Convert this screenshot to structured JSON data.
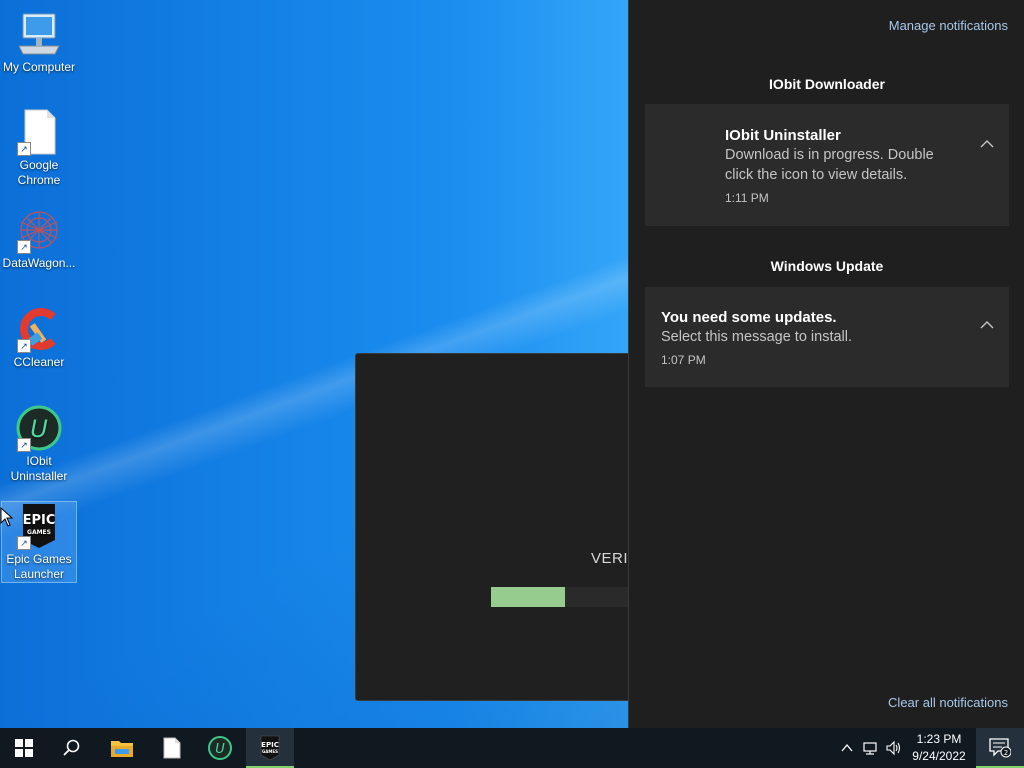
{
  "desktop": {
    "icons": [
      {
        "label": "My Computer",
        "icon": "computer-icon"
      },
      {
        "label": "Google Chrome",
        "icon": "file-icon"
      },
      {
        "label": "DataWagon...",
        "icon": "datawagon-icon"
      },
      {
        "label": "CCleaner",
        "icon": "ccleaner-icon"
      },
      {
        "label": "IObit Uninstaller",
        "icon": "iobit-uninstaller-icon"
      },
      {
        "label": "Epic Games Launcher",
        "icon": "epic-games-icon"
      }
    ]
  },
  "epic_window": {
    "status_text": "VERIF",
    "progress": 0.46,
    "progress_color": "#96cd8e"
  },
  "notifications": {
    "manage_label": "Manage notifications",
    "clear_label": "Clear all notifications",
    "groups": [
      {
        "title": "IObit Downloader",
        "items": [
          {
            "title": "IObit Uninstaller",
            "body": "Download is in progress. Double click the icon to view details.",
            "time": "1:11 PM"
          }
        ]
      },
      {
        "title": "Windows Update",
        "items": [
          {
            "title": "You need some updates.",
            "body": "Select this message to install.",
            "time": "1:07 PM"
          }
        ]
      }
    ]
  },
  "taskbar": {
    "apps": [
      "start-icon",
      "search-icon",
      "file-explorer-icon",
      "notepad-icon",
      "iobit-uninstaller-icon",
      "epic-games-icon"
    ],
    "clock_time": "1:23 PM",
    "clock_date": "9/24/2022",
    "notification_count": "2"
  },
  "colors": {
    "accent_green": "#7fd26d",
    "panel_bg": "#1f1f1f",
    "card_bg": "#2b2b2b",
    "link": "#a8c7ea"
  }
}
